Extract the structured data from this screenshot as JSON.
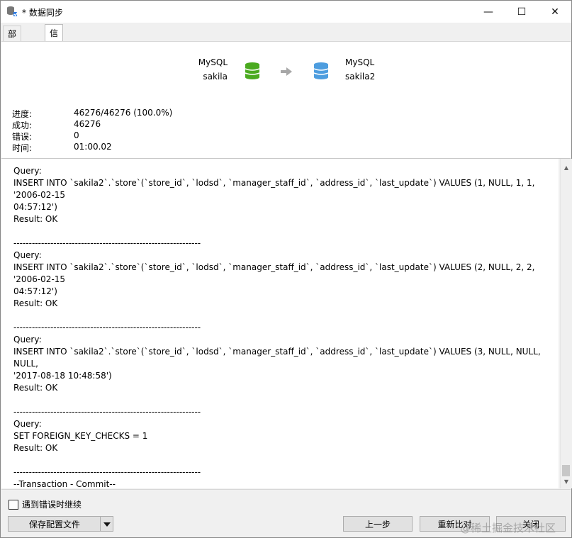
{
  "window": {
    "title": "* 数据同步",
    "controls": {
      "minimize": "—",
      "maximize": "☐",
      "close": "✕"
    }
  },
  "tabs": [
    {
      "label": "部署脚本"
    },
    {
      "label": "信息日志"
    }
  ],
  "source": {
    "type": "MySQL",
    "name": "sakila",
    "icon_color": "#4aaa1f"
  },
  "target": {
    "type": "MySQL",
    "name": "sakila2",
    "icon_color": "#4d9ddf"
  },
  "stats": {
    "progress_label": "进度:",
    "progress_value": "46276/46276 (100.0%)",
    "success_label": "成功:",
    "success_value": "46276",
    "error_label": "错误:",
    "error_value": "0",
    "time_label": "时间:",
    "time_value": "01:00.02"
  },
  "log": {
    "text": "Query:\nINSERT INTO `sakila2`.`store`(`store_id`, `lodsd`, `manager_staff_id`, `address_id`, `last_update`) VALUES (1, NULL, 1, 1, '2006-02-15\n04:57:12')\nResult: OK\n\n-------------------------------------------------------------\nQuery:\nINSERT INTO `sakila2`.`store`(`store_id`, `lodsd`, `manager_staff_id`, `address_id`, `last_update`) VALUES (2, NULL, 2, 2, '2006-02-15\n04:57:12')\nResult: OK\n\n-------------------------------------------------------------\nQuery:\nINSERT INTO `sakila2`.`store`(`store_id`, `lodsd`, `manager_staff_id`, `address_id`, `last_update`) VALUES (3, NULL, NULL, NULL,\n'2017-08-18 10:48:58')\nResult: OK\n\n-------------------------------------------------------------\nQuery:\nSET FOREIGN_KEY_CHECKS = 1\nResult: OK\n\n-------------------------------------------------------------\n--Transaction - Commit--\n--End--"
  },
  "footer": {
    "continue_on_error_label": "遇到错误时继续",
    "save_profile_label": "保存配置文件",
    "back_label": "上一步",
    "recompare_label": "重新比对",
    "close_label": "关闭"
  },
  "watermark": "@稀土掘金技术社区"
}
